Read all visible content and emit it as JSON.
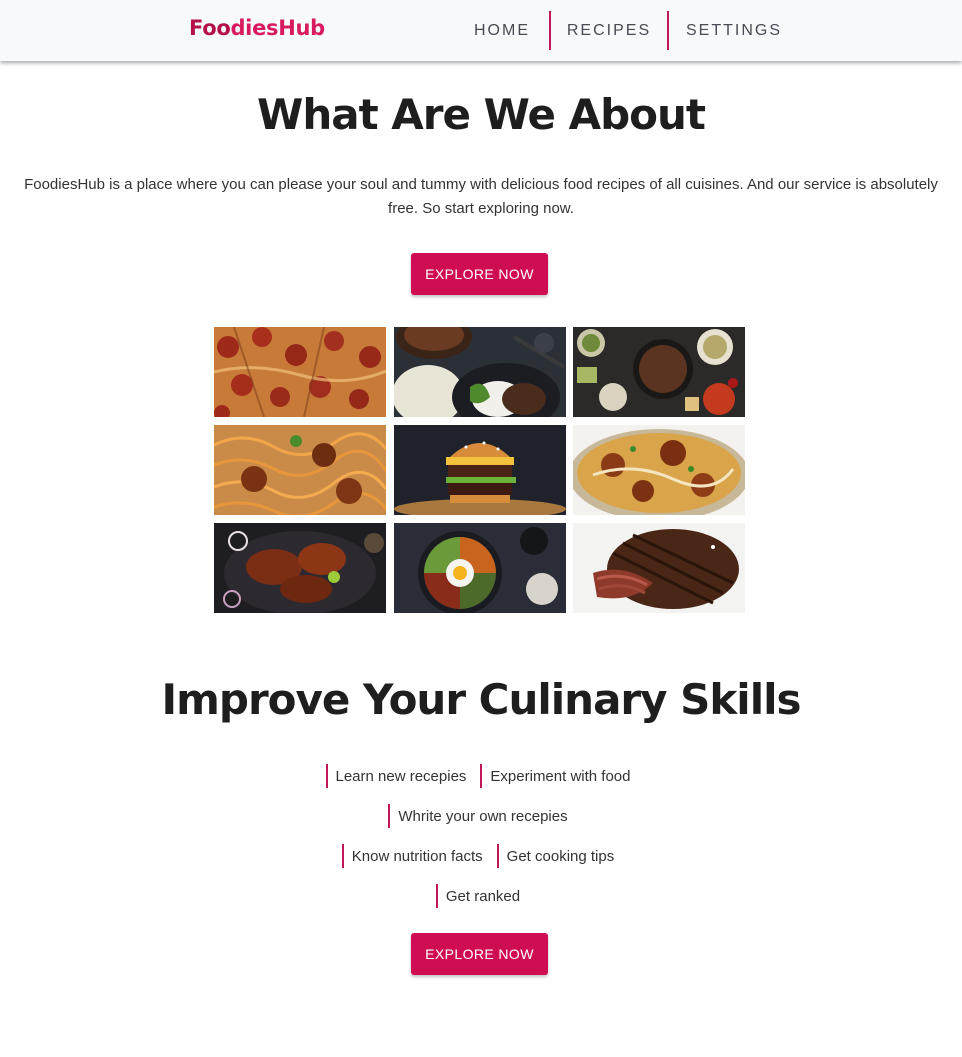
{
  "navbar": {
    "logo_part1": "Foo",
    "logo_part2": "diesHub",
    "links": [
      "HOME",
      "RECIPES",
      "SETTINGS"
    ]
  },
  "about": {
    "title": "What Are We About",
    "text": "FoodiesHub is a place where you can please your soul and tummy with delicious food recipes of all cuisines. And our service is absolutely free. So start exploring now.",
    "button": "EXPLORE NOW"
  },
  "gallery": {
    "images": [
      "pepperoni-pizza",
      "rice-bowl",
      "korean-bbq-spread",
      "spaghetti-meatballs",
      "burger",
      "biryani",
      "tandoori-chicken",
      "bibimbap",
      "grilled-steak"
    ]
  },
  "skills": {
    "title": "Improve Your Culinary Skills",
    "rows": [
      [
        "Learn new recepies",
        "Experiment with food"
      ],
      [
        "Whrite your own recepies"
      ],
      [
        "Know nutrition facts",
        "Get cooking tips"
      ],
      [
        "Get ranked"
      ]
    ],
    "button": "EXPLORE NOW"
  },
  "colors": {
    "accent": "#cf0d55",
    "divider": "#c2185b",
    "navbar_bg": "#f8f9fb"
  }
}
